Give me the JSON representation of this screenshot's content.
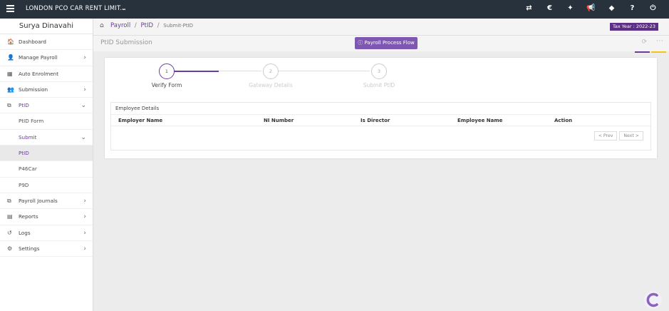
{
  "topbar": {
    "company": "LONDON PCO CAR RENT LIMIT...",
    "caret": "⌄",
    "icons": [
      {
        "name": "transfer-icon",
        "glyph": "⇄"
      },
      {
        "name": "currency-icon",
        "glyph": "€"
      },
      {
        "name": "users-icon",
        "glyph": "✦"
      },
      {
        "name": "announcement-icon",
        "glyph": "📢"
      },
      {
        "name": "tag-icon",
        "glyph": "◆"
      },
      {
        "name": "help-icon",
        "glyph": "?"
      },
      {
        "name": "power-icon",
        "glyph": "⏻"
      }
    ]
  },
  "sidebar": {
    "user": "Surya Dinavahi",
    "items": [
      {
        "label": "Dashboard",
        "icon": "🏠"
      },
      {
        "label": "Manage Payroll",
        "icon": "👤"
      },
      {
        "label": "Auto Enrolment",
        "icon": "▦"
      },
      {
        "label": "Submission",
        "icon": "👥"
      },
      {
        "label": "PtID",
        "icon": "⧉"
      },
      {
        "label": "PtID Form"
      },
      {
        "label": "Submit"
      },
      {
        "label": "PtID"
      },
      {
        "label": "P46Car"
      },
      {
        "label": "P9D"
      },
      {
        "label": "Payroll Journals",
        "icon": "⧉"
      },
      {
        "label": "Reports",
        "icon": "▤"
      },
      {
        "label": "Logs",
        "icon": "↺"
      },
      {
        "label": "Settings",
        "icon": "⚙"
      }
    ]
  },
  "breadcrumb": {
    "items": [
      "Payroll",
      "PtID",
      "Submit-PtID"
    ],
    "separator": "/"
  },
  "tax_year": "Tax Year : 2022-23",
  "page": {
    "title": "PtID Submission",
    "flow_button": "Payroll Process Flow"
  },
  "stepper": {
    "steps": [
      {
        "number": "1",
        "label": "Verify Form"
      },
      {
        "number": "2",
        "label": "Gateway Details"
      },
      {
        "number": "3",
        "label": "Submit PtID"
      }
    ]
  },
  "table": {
    "heading": "Employee Details",
    "columns": [
      "Employer Name",
      "NI Number",
      "Is Director",
      "Employee Name",
      "Action"
    ]
  },
  "pager": {
    "prev": "< Prev",
    "next": "Next >"
  },
  "colors": {
    "topbar": "#28323c",
    "accent": "#6a3d9a",
    "button": "#7e57b2",
    "yellow": "#f0c419"
  }
}
